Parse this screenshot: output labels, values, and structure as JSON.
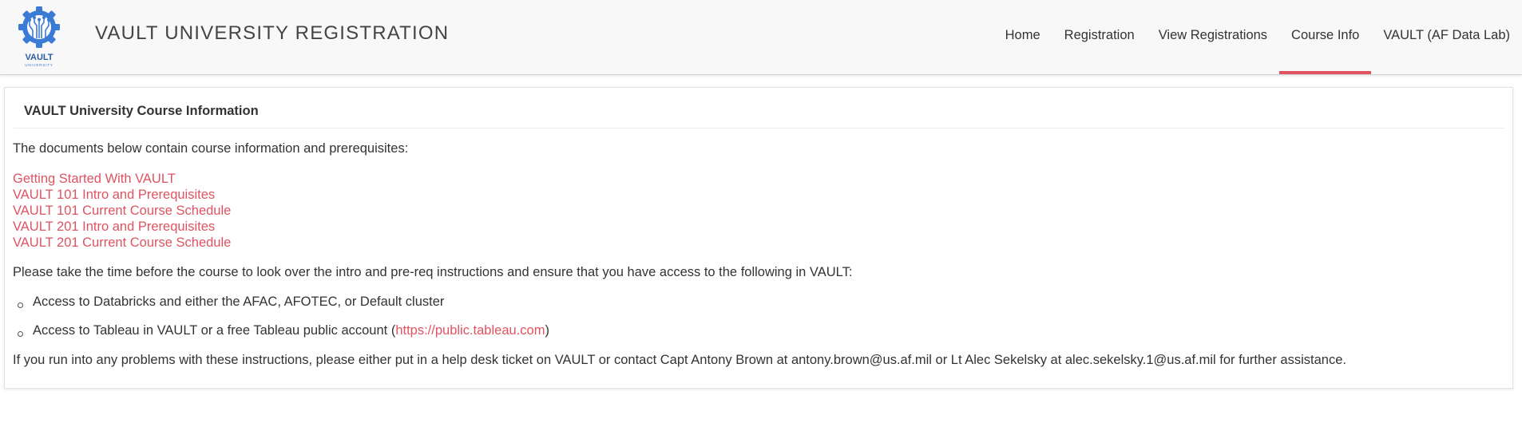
{
  "logo": {
    "text": "VAULT",
    "subtext": "UNIVERSITY",
    "accent": "#3a7bd5"
  },
  "header": {
    "title": "VAULT UNIVERSITY REGISTRATION"
  },
  "nav": {
    "items": [
      {
        "label": "Home"
      },
      {
        "label": "Registration"
      },
      {
        "label": "View Registrations"
      },
      {
        "label": "Course Info",
        "active": true
      },
      {
        "label": "VAULT (AF Data Lab)"
      }
    ],
    "active_color": "#e05361"
  },
  "panel": {
    "title": "VAULT University Course Information",
    "intro": "The documents below contain course information and prerequisites:",
    "documents": [
      "Getting Started With VAULT",
      "VAULT 101 Intro and Prerequisites",
      "VAULT 101 Current Course Schedule",
      "VAULT 201 Intro and Prerequisites",
      "VAULT 201 Current Course Schedule"
    ],
    "instructions": "Please take the time before the course to look over the intro and pre-req instructions and ensure that you have access to the following in VAULT:",
    "requirements": {
      "databricks": "Access to Databricks and either the AFAC, AFOTEC, or Default cluster",
      "tableau_prefix": "Access to Tableau in VAULT or a free Tableau public account (",
      "tableau_link": "https://public.tableau.com",
      "tableau_suffix": ")"
    },
    "help": "If you run into any problems with these instructions, please either put in a help desk ticket on VAULT or contact Capt Antony Brown at antony.brown@us.af.mil or Lt Alec Sekelsky at alec.sekelsky.1@us.af.mil for further assistance."
  },
  "colors": {
    "link": "#e05361",
    "text": "#333333"
  }
}
